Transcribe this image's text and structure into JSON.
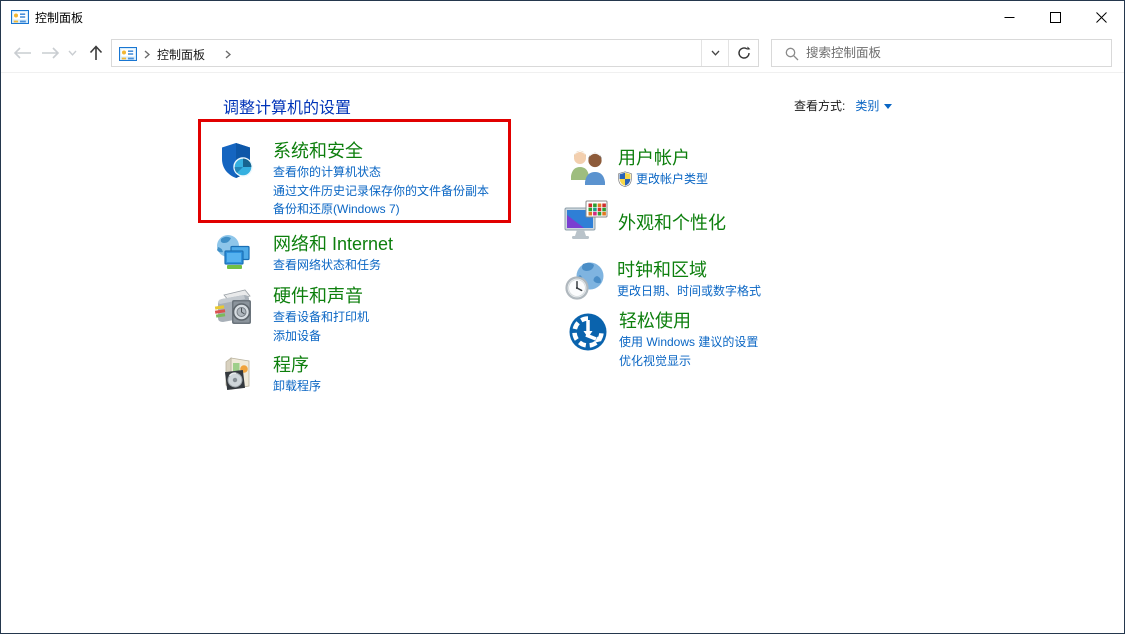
{
  "window": {
    "title": "控制面板"
  },
  "nav": {
    "breadcrumb_root": "控制面板"
  },
  "search": {
    "placeholder": "搜索控制面板"
  },
  "header": {
    "title": "调整计算机的设置",
    "view_by_label": "查看方式:",
    "view_by_value": "类别"
  },
  "categories": {
    "left": [
      {
        "title": "系统和安全",
        "links": [
          "查看你的计算机状态",
          "通过文件历史记录保存你的文件备份副本",
          "备份和还原(Windows 7)"
        ]
      },
      {
        "title": "网络和 Internet",
        "links": [
          "查看网络状态和任务"
        ]
      },
      {
        "title": "硬件和声音",
        "links": [
          "查看设备和打印机",
          "添加设备"
        ]
      },
      {
        "title": "程序",
        "links": [
          "卸载程序"
        ]
      }
    ],
    "right": [
      {
        "title": "用户帐户",
        "links": [
          "更改帐户类型"
        ]
      },
      {
        "title": "外观和个性化",
        "links": []
      },
      {
        "title": "时钟和区域",
        "links": [
          "更改日期、时间或数字格式"
        ]
      },
      {
        "title": "轻松使用",
        "links": [
          "使用 Windows 建议的设置",
          "优化视觉显示"
        ]
      }
    ]
  },
  "colors": {
    "category_title": "#0d7f0d",
    "link": "#0a66c4",
    "heading": "#0033b8",
    "highlight_border": "#e10000"
  }
}
